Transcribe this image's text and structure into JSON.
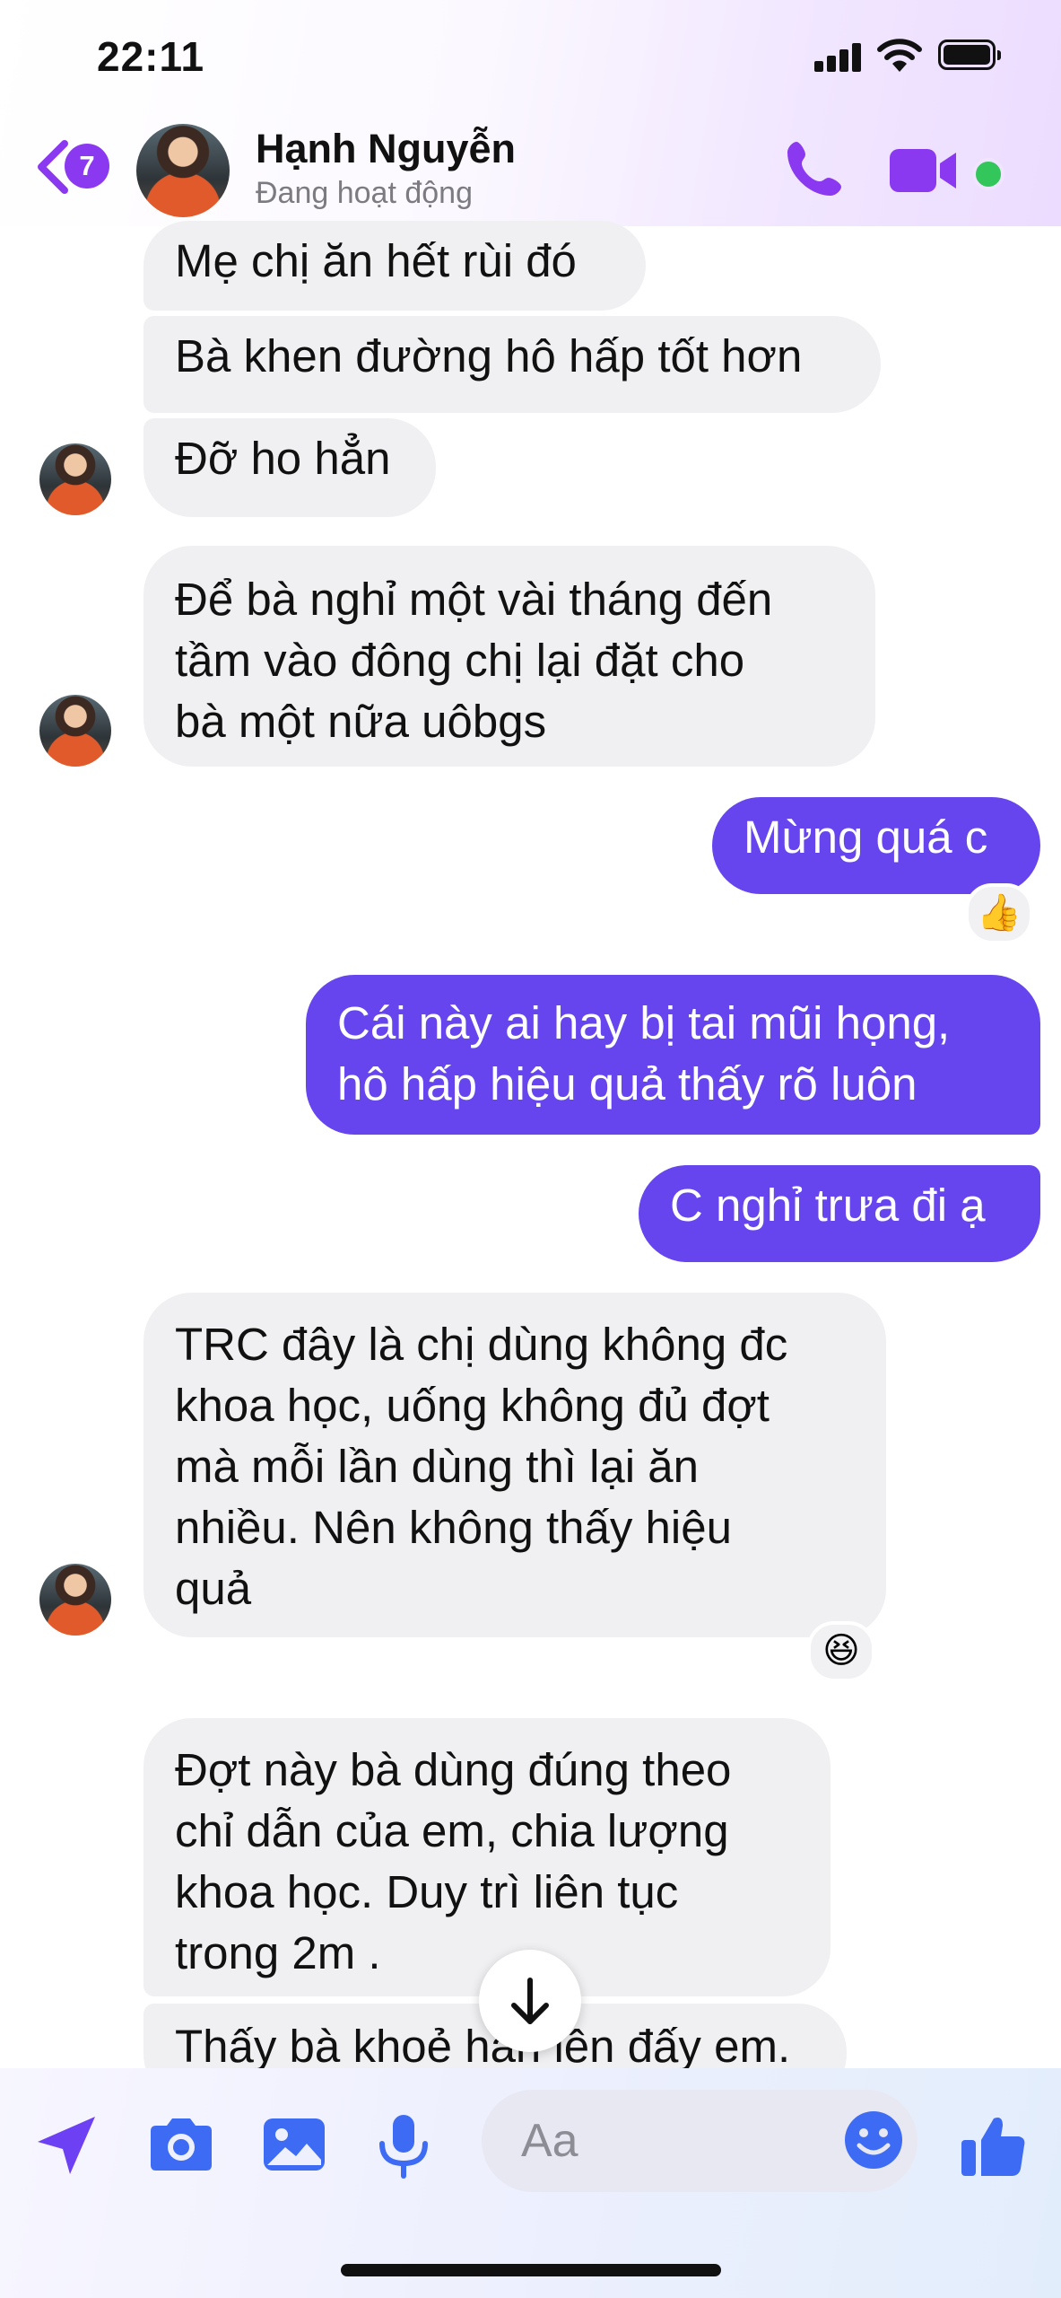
{
  "status_bar": {
    "time": "22:11"
  },
  "header": {
    "unread_count": "7",
    "contact_name": "Hạnh Nguyễn",
    "presence": "Đang hoạt động"
  },
  "messages": [
    {
      "direction": "incoming",
      "text": "Mẹ chị ăn hết rùi đó"
    },
    {
      "direction": "incoming",
      "text": "Bà khen đường hô hấp tốt hơn"
    },
    {
      "direction": "incoming",
      "text": "Đỡ ho hẳn"
    },
    {
      "direction": "incoming",
      "text": "Để bà nghỉ một vài tháng đến\ntầm vào đông chị lại đặt cho\nbà một nữa uôbgs"
    },
    {
      "direction": "outgoing",
      "text": "Mừng quá c",
      "reaction": "👍"
    },
    {
      "direction": "outgoing",
      "text": "Cái này ai hay bị tai mũi họng,\nhô hấp hiệu quả thấy rõ luôn"
    },
    {
      "direction": "outgoing",
      "text": "C nghỉ trưa đi ạ"
    },
    {
      "direction": "incoming",
      "text": "TRC đây là chị dùng không đc\nkhoa học, uống không đủ đợt\nmà mỗi lần dùng thì lại ăn\nnhiều. Nên không thấy hiệu\nquả",
      "reaction": "😆"
    },
    {
      "direction": "incoming",
      "text": "Đợt này bà dùng đúng theo\nchỉ dẫn của em, chia lượng\nkhoa học. Duy trì liên tục\ntrong 2m ."
    },
    {
      "direction": "incoming",
      "text": "Thấy bà khoẻ han lên đấy em."
    }
  ],
  "composer": {
    "placeholder": "Aa"
  },
  "colors": {
    "accent": "#8b39f0",
    "outgoing_bubble": "#6645ef",
    "incoming_bubble": "#f0f0f2",
    "online": "#32c65b"
  },
  "icons": [
    "chevron-left-icon",
    "phone-icon",
    "video-camera-icon",
    "send-location-icon",
    "camera-icon",
    "photo-icon",
    "microphone-icon",
    "smile-icon",
    "thumbs-up-icon",
    "arrow-down-icon"
  ]
}
